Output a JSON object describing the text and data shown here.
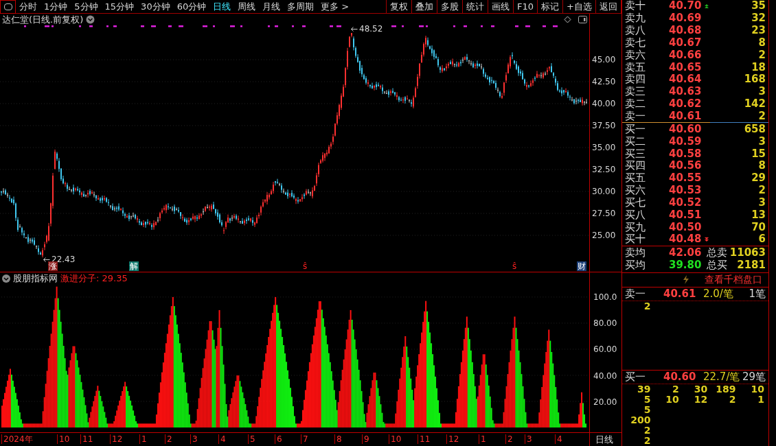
{
  "toolbar": {
    "period_tabs": [
      {
        "label": "分时",
        "selected": false
      },
      {
        "label": "1分钟",
        "selected": false
      },
      {
        "label": "5分钟",
        "selected": false
      },
      {
        "label": "15分钟",
        "selected": false
      },
      {
        "label": "30分钟",
        "selected": false
      },
      {
        "label": "60分钟",
        "selected": false
      },
      {
        "label": "日线",
        "selected": true
      },
      {
        "label": "周线",
        "selected": false
      },
      {
        "label": "月线",
        "selected": false
      },
      {
        "label": "多周期",
        "selected": false
      },
      {
        "label": "更多 >",
        "selected": false
      }
    ],
    "actions": [
      "复权",
      "叠加",
      "多股",
      "统计",
      "画线",
      "F10",
      "标记",
      "+自选",
      "返回"
    ]
  },
  "chart": {
    "title": "达仁堂(日线.前复权)",
    "high_label": "48.52",
    "low_label": "22.43",
    "y_labels": [
      "45.00",
      "42.50",
      "40.00",
      "37.50",
      "35.00",
      "32.50",
      "30.00",
      "27.50",
      "25.00"
    ],
    "event_markers": [
      {
        "text": "涨",
        "kind": "tag",
        "color": "#8b1a1a"
      },
      {
        "text": "解",
        "kind": "tag",
        "color": "#0f7a6e"
      },
      {
        "text": "ŝ",
        "kind": "plain",
        "color": "#ff2020"
      },
      {
        "text": "ŝ",
        "kind": "plain",
        "color": "#ff2020"
      },
      {
        "text": "财",
        "kind": "tag",
        "color": "#1c3f78"
      }
    ]
  },
  "indicator": {
    "title": "股朋指标网",
    "value": "激进分子: 29.35",
    "y_labels": [
      "100.0",
      "80.00",
      "60.00",
      "40.00",
      "20.00"
    ]
  },
  "x_axis": {
    "labels": [
      "2024年",
      "10",
      "11",
      "12",
      "1",
      "2",
      "3",
      "4",
      "5",
      "6",
      "7",
      "8",
      "9",
      "10",
      "11",
      "12",
      "1",
      "2",
      "3",
      "4"
    ],
    "period": "日线"
  },
  "order_book": {
    "sells": [
      {
        "name": "卖十",
        "price": "40.70",
        "volume": "35",
        "kind": "rising"
      },
      {
        "name": "卖九",
        "price": "40.69",
        "volume": "32",
        "kind": "plain"
      },
      {
        "name": "卖八",
        "price": "40.68",
        "volume": "23",
        "kind": "plain"
      },
      {
        "name": "卖七",
        "price": "40.67",
        "volume": "8",
        "kind": "plain"
      },
      {
        "name": "卖六",
        "price": "40.66",
        "volume": "2",
        "kind": "plain"
      },
      {
        "name": "卖五",
        "price": "40.65",
        "volume": "18",
        "kind": "plain"
      },
      {
        "name": "卖四",
        "price": "40.64",
        "volume": "168",
        "kind": "plain"
      },
      {
        "name": "卖三",
        "price": "40.63",
        "volume": "3",
        "kind": "plain"
      },
      {
        "name": "卖二",
        "price": "40.62",
        "volume": "142",
        "kind": "plain"
      },
      {
        "name": "卖一",
        "price": "40.61",
        "volume": "2",
        "kind": "plain"
      }
    ],
    "buys": [
      {
        "name": "买一",
        "price": "40.60",
        "volume": "658",
        "kind": "plain"
      },
      {
        "name": "买二",
        "price": "40.59",
        "volume": "3",
        "kind": "plain"
      },
      {
        "name": "买三",
        "price": "40.58",
        "volume": "15",
        "kind": "plain"
      },
      {
        "name": "买四",
        "price": "40.56",
        "volume": "8",
        "kind": "plain"
      },
      {
        "name": "买五",
        "price": "40.55",
        "volume": "29",
        "kind": "plain"
      },
      {
        "name": "买六",
        "price": "40.53",
        "volume": "2",
        "kind": "plain"
      },
      {
        "name": "买七",
        "price": "40.52",
        "volume": "3",
        "kind": "plain"
      },
      {
        "name": "买八",
        "price": "40.51",
        "volume": "13",
        "kind": "plain"
      },
      {
        "name": "买九",
        "price": "40.50",
        "volume": "70",
        "kind": "plain"
      },
      {
        "name": "买十",
        "price": "40.48",
        "volume": "6",
        "kind": "falling"
      }
    ],
    "summary": [
      {
        "label": "卖均",
        "price": "42.06",
        "color": "#ff4040",
        "total_label": "总卖",
        "total": "11063"
      },
      {
        "label": "买均",
        "price": "39.80",
        "color": "#20e020",
        "total_label": "总买",
        "total": "2181"
      }
    ],
    "link": "查看千档盘口"
  },
  "queues": [
    {
      "label": "卖一",
      "price": "40.61",
      "avg": "2.0/笔",
      "count": "1笔",
      "orders": [
        [
          "2"
        ]
      ]
    },
    {
      "label": "买一",
      "price": "40.60",
      "avg": "22.7/笔",
      "count": "29笔",
      "orders": [
        [
          "39",
          "2",
          "30",
          "189",
          "10"
        ],
        [
          "5",
          "10",
          "12",
          "2",
          "1"
        ],
        [
          "5"
        ],
        [
          "200"
        ],
        [
          "2"
        ],
        [
          "2"
        ]
      ]
    }
  ]
}
